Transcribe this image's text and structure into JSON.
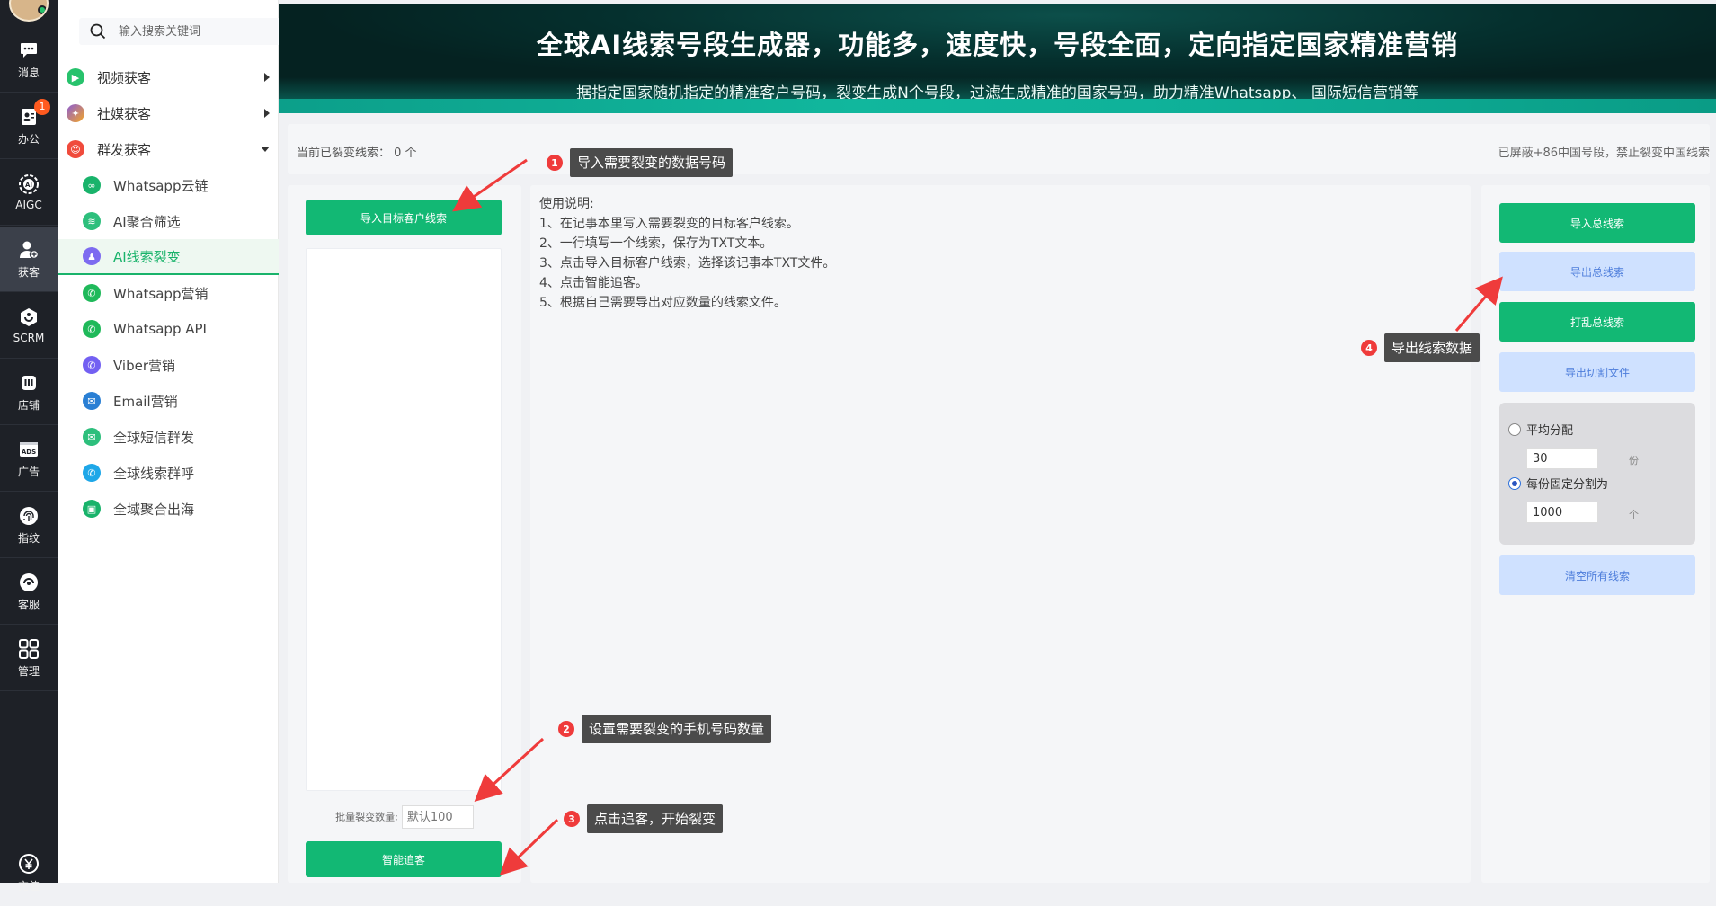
{
  "rail": {
    "items": [
      {
        "label": "消息",
        "icon": "chat-icon"
      },
      {
        "label": "办公",
        "icon": "office-icon",
        "badge": "1"
      },
      {
        "label": "AIGC",
        "icon": "aigc-icon"
      },
      {
        "label": "获客",
        "icon": "customer-icon"
      },
      {
        "label": "SCRM",
        "icon": "scrm-icon"
      },
      {
        "label": "店铺",
        "icon": "store-icon"
      },
      {
        "label": "广告",
        "icon": "ads-icon"
      },
      {
        "label": "指纹",
        "icon": "fingerprint-icon"
      },
      {
        "label": "客服",
        "icon": "service-icon"
      },
      {
        "label": "管理",
        "icon": "grid-icon"
      },
      {
        "label": "充值",
        "icon": "yuan-icon"
      }
    ],
    "active": "获客"
  },
  "menu": {
    "search_placeholder": "输入搜索关键词",
    "groups": [
      {
        "label": "视频获客",
        "color": "#27c26c",
        "expanded": false
      },
      {
        "label": "社媒获客",
        "color": "#8a5cd6",
        "expanded": false
      },
      {
        "label": "群发获客",
        "color": "#f04b3c",
        "expanded": true
      }
    ],
    "sub_items": [
      {
        "label": "Whatsapp云链",
        "icon": "cloud-chain-icon",
        "color": "#19b36b"
      },
      {
        "label": "AI聚合筛选",
        "icon": "filter-icon",
        "color": "#2dbf7c"
      },
      {
        "label": "AI线索裂变",
        "icon": "fission-icon",
        "color": "#7d6bf0"
      },
      {
        "label": "Whatsapp营销",
        "icon": "whatsapp-icon",
        "color": "#1fb95a"
      },
      {
        "label": "Whatsapp API",
        "icon": "whatsapp-icon",
        "color": "#1fb95a"
      },
      {
        "label": "Viber营销",
        "icon": "viber-icon",
        "color": "#7360f2"
      },
      {
        "label": "Email营销",
        "icon": "email-icon",
        "color": "#2a7fd4"
      },
      {
        "label": "全球短信群发",
        "icon": "sms-icon",
        "color": "#2dbf7c"
      },
      {
        "label": "全球线索群呼",
        "icon": "phone-icon",
        "color": "#1ea7e8"
      },
      {
        "label": "全域聚合出海",
        "icon": "aggregate-icon",
        "color": "#19b36b"
      }
    ],
    "active": "AI线索裂变"
  },
  "banner": {
    "title": "全球AI线索号段生成器，功能多，速度快，号段全面，定向指定国家精准营销",
    "subtitle": "据指定国家随机指定的精准客户号码，裂变生成N个号段，过滤生成精准的国家号码，助力精准Whatsapp、 国际短信营销等"
  },
  "status": {
    "left_label": "当前已裂变线索：",
    "count": "0 个",
    "right_note": "已屏蔽+86中国号段，禁止裂变中国线索"
  },
  "left_panel": {
    "import_button": "导入目标客户线索",
    "batch_label": "批量裂变数量:",
    "batch_placeholder": "默认100",
    "smart_button": "智能追客"
  },
  "instructions": {
    "heading": "使用说明:",
    "lines": [
      "1、在记事本里写入需要裂变的目标客户线索。",
      "2、一行填写一个线索，保存为TXT文本。",
      "3、点击导入目标客户线索，选择该记事本TXT文件。",
      "4、点击智能追客。",
      "5、根据自己需要导出对应数量的线索文件。"
    ]
  },
  "right_panel": {
    "import_total": "导入总线索",
    "export_total": "导出总线索",
    "shuffle_total": "打乱总线索",
    "export_cut": "导出切割文件",
    "split": {
      "option_even": "平均分配",
      "even_value": "30",
      "even_unit": "份",
      "option_fixed": "每份固定分割为",
      "fixed_value": "1000",
      "fixed_unit": "个",
      "selected": "fixed"
    },
    "clear_all": "清空所有线索"
  },
  "callouts": [
    {
      "num": "1",
      "text": "导入需要裂变的数据号码"
    },
    {
      "num": "2",
      "text": "设置需要裂变的手机号码数量"
    },
    {
      "num": "3",
      "text": "点击追客，开始裂变"
    },
    {
      "num": "4",
      "text": "导出线索数据"
    }
  ],
  "colors": {
    "accent_green": "#12b874",
    "light_blue_button": "#cfe1ff",
    "callout_red": "#ef3b3b",
    "rail_bg": "#1e2127"
  }
}
